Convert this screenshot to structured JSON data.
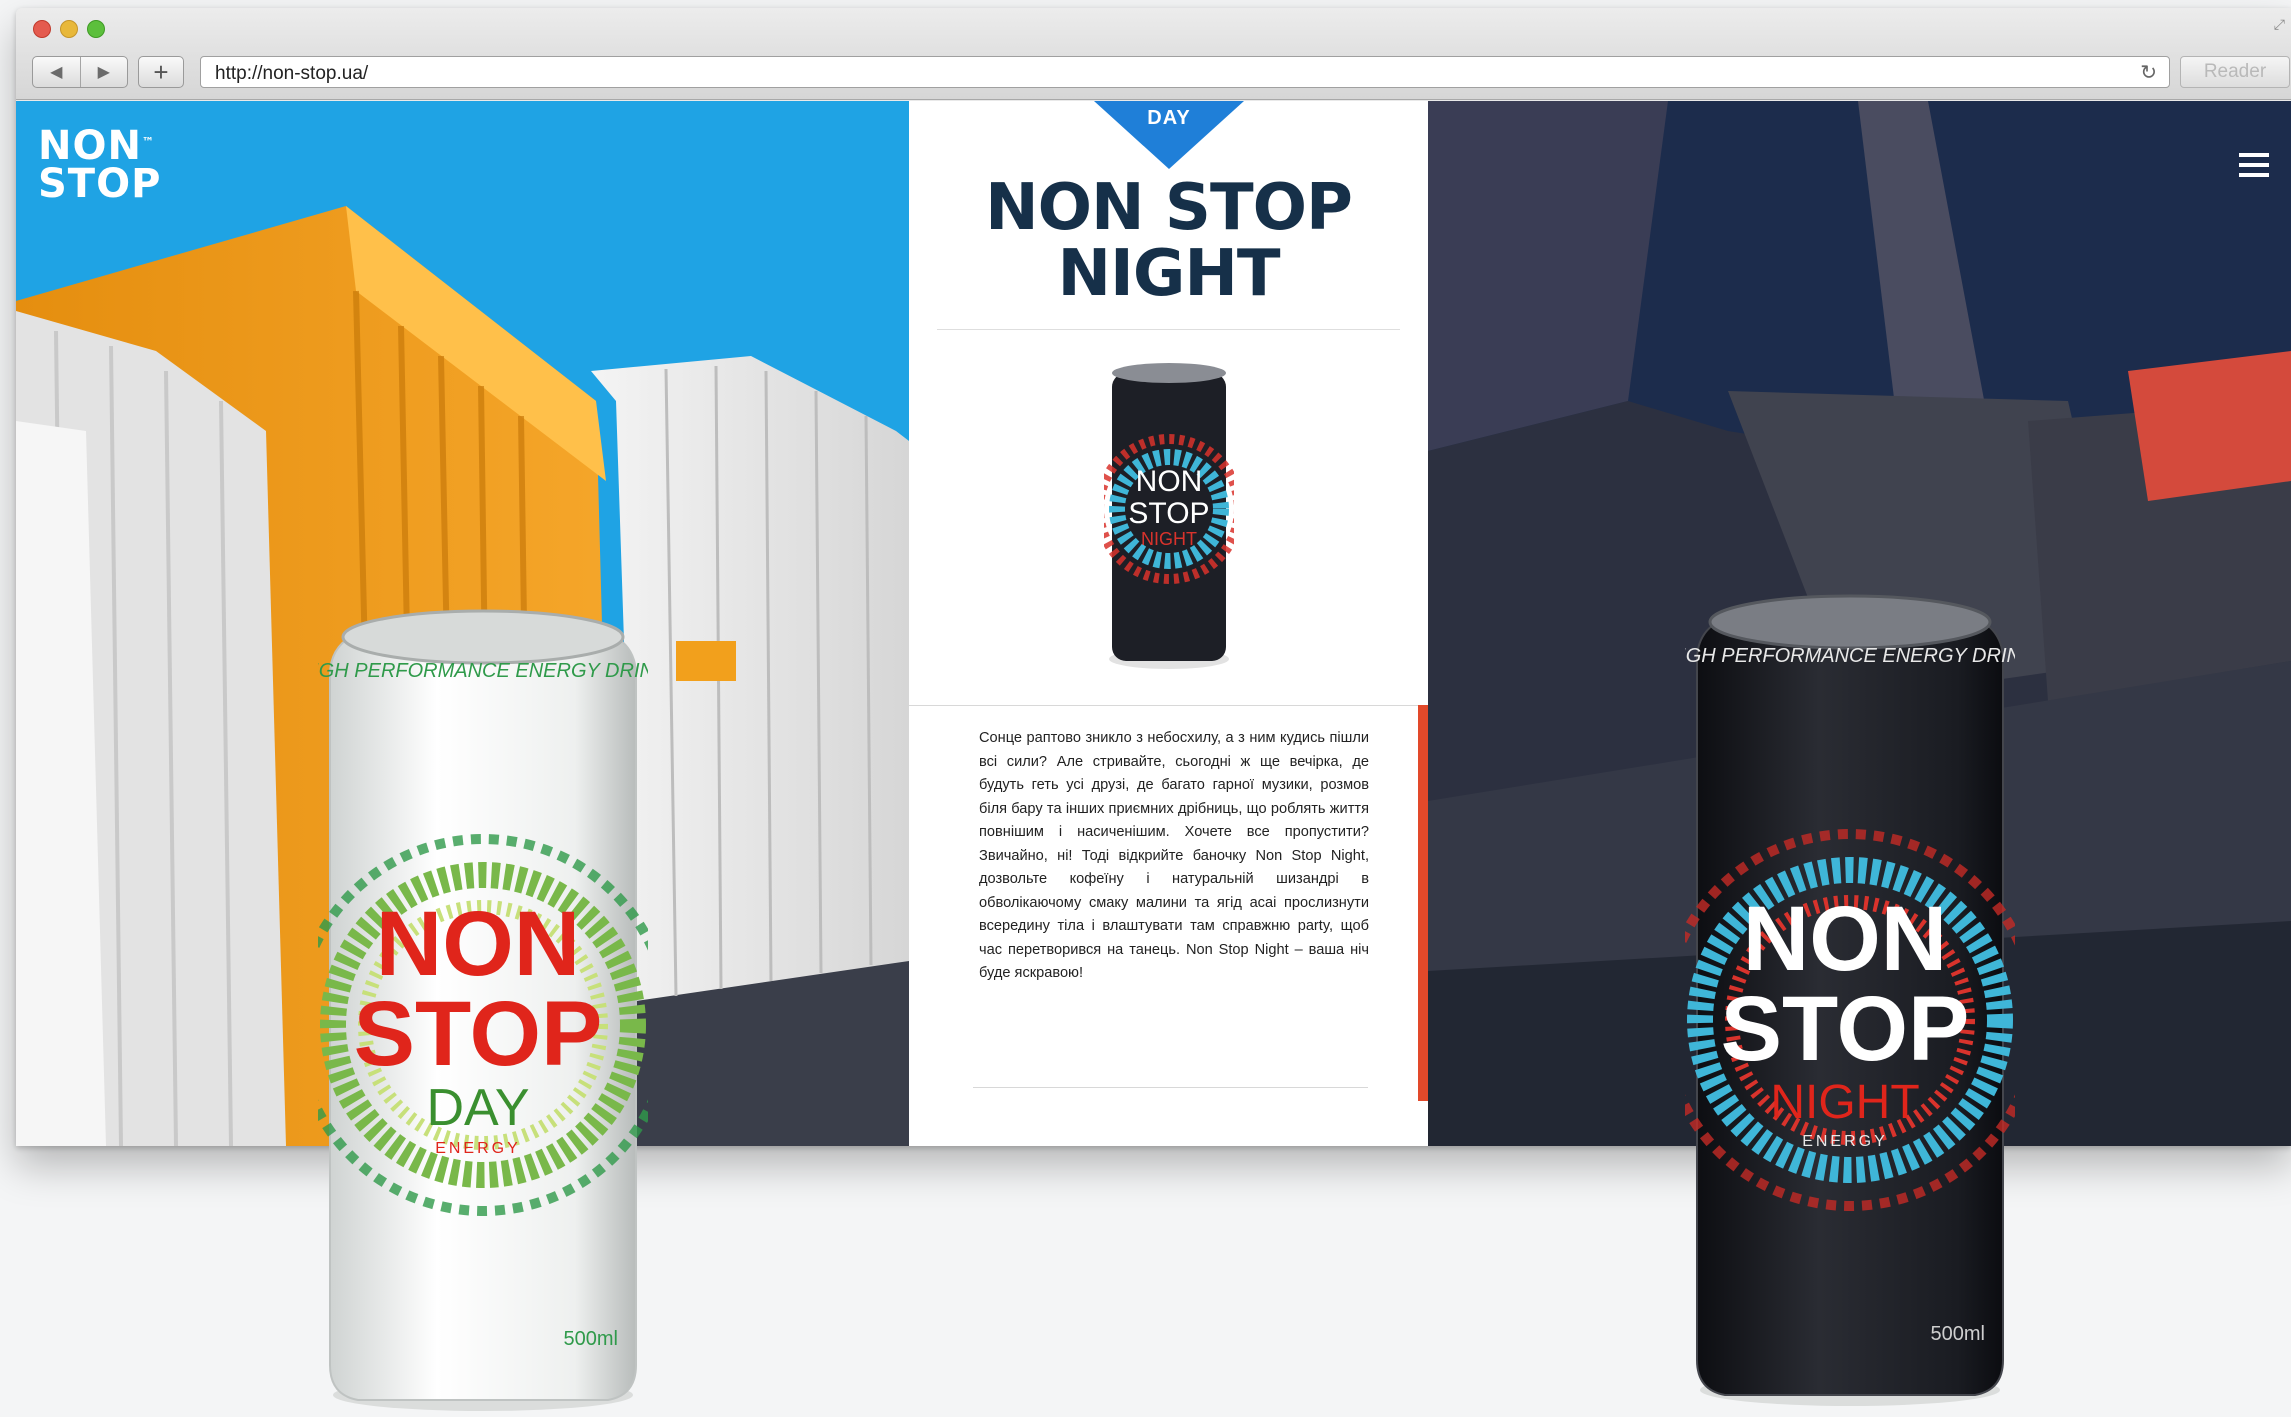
{
  "browser": {
    "url": "http://non-stop.ua/",
    "reader_label": "Reader",
    "add_tab_label": "+",
    "back_icon": "back-arrow-icon",
    "forward_icon": "forward-arrow-icon",
    "reload_icon": "reload-icon"
  },
  "site": {
    "logo_line1": "NON",
    "logo_line2": "STOP",
    "logo_tm": "™",
    "menu_icon": "hamburger-menu-icon"
  },
  "center": {
    "tab_label": "DAY",
    "title_line1": "NON STOP",
    "title_line2": "NIGHT",
    "description": "Сонце раптово зникло з небосхилу, а з ним кудись пішли всі сили? Але стривайте, сьогодні ж ще вечірка, де будуть геть усі друзі, де багато гарної музики, розмов біля бару та інших приємних дрібниць, що роблять життя повнішим і насиченішим. Хочете все пропустити? Звичайно, ні! Тоді відкрийте баночку Non Stop Night, дозвольте кофеїну і натуральній шизандрі в обволікаючому смаку малини та ягід асаі прослизнути всередину тіла і влаштувати там справжню party, щоб час перетворився на танець. Non Stop Night – ваша ніч буде яскравою!"
  },
  "small_can": {
    "line1": "NON",
    "line2": "STOP",
    "line3": "NIGHT"
  },
  "can_day": {
    "ring_text": "HIGH PERFORMANCE ENERGY DRINK",
    "brand_line1": "NON",
    "brand_line2": "STOP",
    "variant": "DAY",
    "energy": "ENERGY",
    "volume": "500ml"
  },
  "can_night": {
    "ring_text": "HIGH PERFORMANCE ENERGY DRINK",
    "brand_line1": "NON",
    "brand_line2": "STOP",
    "variant": "NIGHT",
    "energy": "ENERGY",
    "volume": "500ml"
  },
  "colors": {
    "sky_day": "#1fa3e4",
    "building_orange": "#f2a01c",
    "night_bg": "#1c2c4c",
    "title_navy": "#163049",
    "accent_red": "#e2492a",
    "day_tab_blue": "#1f7fd8"
  }
}
